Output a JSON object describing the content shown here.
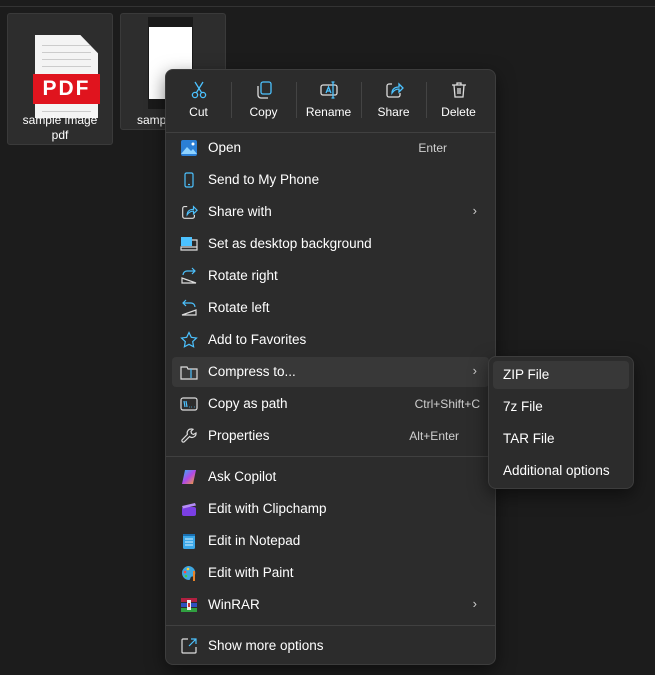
{
  "files": [
    {
      "name_line1": "sample image",
      "name_line2": "pdf",
      "badge": "PDF"
    },
    {
      "name": "samp"
    }
  ],
  "toolbar": [
    {
      "label": "Cut",
      "icon": "scissors-icon"
    },
    {
      "label": "Copy",
      "icon": "copy-icon"
    },
    {
      "label": "Rename",
      "icon": "rename-icon"
    },
    {
      "label": "Share",
      "icon": "share-icon"
    },
    {
      "label": "Delete",
      "icon": "trash-icon"
    }
  ],
  "menu": {
    "items": [
      {
        "label": "Open",
        "shortcut": "Enter"
      },
      {
        "label": "Send to My Phone"
      },
      {
        "label": "Share with",
        "submenu": "›"
      },
      {
        "label": "Set as desktop background"
      },
      {
        "label": "Rotate right"
      },
      {
        "label": "Rotate left"
      },
      {
        "label": "Add to Favorites"
      },
      {
        "label": "Compress to...",
        "submenu": "›"
      },
      {
        "label": "Copy as path",
        "shortcut": "Ctrl+Shift+C"
      },
      {
        "label": "Properties",
        "shortcut": "Alt+Enter"
      },
      {
        "label": "Ask Copilot"
      },
      {
        "label": "Edit with Clipchamp"
      },
      {
        "label": "Edit in Notepad"
      },
      {
        "label": "Edit with Paint"
      },
      {
        "label": "WinRAR",
        "submenu": "›"
      },
      {
        "label": "Show more options"
      }
    ]
  },
  "submenu": {
    "items": [
      {
        "label": "ZIP File"
      },
      {
        "label": "7z File"
      },
      {
        "label": "TAR File"
      },
      {
        "label": "Additional options"
      }
    ]
  },
  "colors": {
    "accent": "#4cc2ff",
    "menu_bg": "#2c2c2c",
    "pdf_red": "#e0141e"
  }
}
